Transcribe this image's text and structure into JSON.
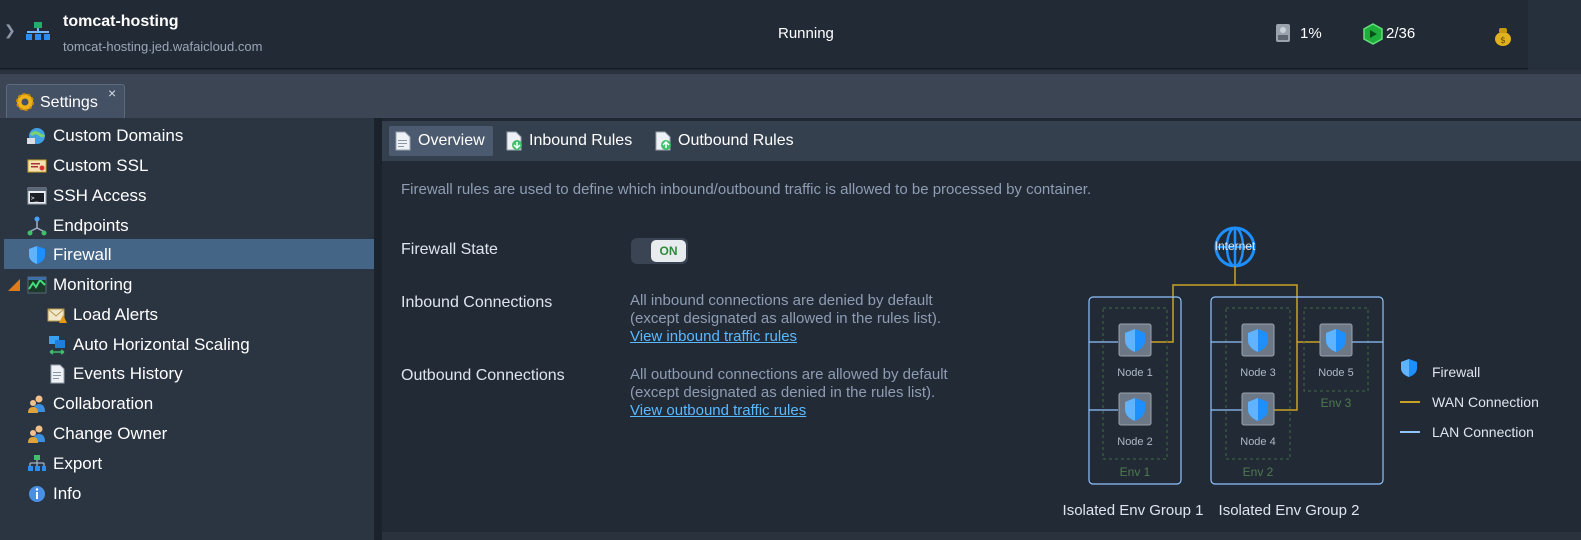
{
  "env": {
    "name": "tomcat-hosting",
    "domain": "tomcat-hosting.jed.wafaicloud.com",
    "status": "Running",
    "disk_usage": "1%",
    "cloudlets": "2/36",
    "icons": [
      "chevron-right-icon",
      "environment-topology-icon",
      "disk-icon",
      "cloudlet-icon",
      "billing-bag-icon"
    ]
  },
  "tab": {
    "label": "Settings",
    "close": "×"
  },
  "sidebar": {
    "items": [
      {
        "label": "Custom Domains"
      },
      {
        "label": "Custom SSL"
      },
      {
        "label": "SSH Access"
      },
      {
        "label": "Endpoints"
      },
      {
        "label": "Firewall"
      },
      {
        "label": "Monitoring"
      },
      {
        "label": "Load Alerts"
      },
      {
        "label": "Auto Horizontal Scaling"
      },
      {
        "label": "Events History"
      },
      {
        "label": "Collaboration"
      },
      {
        "label": "Change Owner"
      },
      {
        "label": "Export"
      },
      {
        "label": "Info"
      }
    ],
    "selected": "Firewall"
  },
  "subtabs": [
    {
      "label": "Overview"
    },
    {
      "label": "Inbound Rules"
    },
    {
      "label": "Outbound Rules"
    }
  ],
  "main": {
    "intro": "Firewall rules are used to define which inbound/outbound traffic is allowed to be processed by container.",
    "firewall_state": {
      "label": "Firewall State",
      "toggle": "ON"
    },
    "inbound": {
      "label": "Inbound Connections",
      "line1": "All inbound connections are denied by default",
      "line2": "(except designated as allowed in the rules list).",
      "link": "View inbound traffic rules"
    },
    "outbound": {
      "label": "Outbound Connections",
      "line1": "All outbound connections are allowed by default",
      "line2": "(except designated as denied in the rules list).",
      "link": "View outbound traffic rules"
    }
  },
  "diagram": {
    "internet": "Internet",
    "nodes": [
      "Node 1",
      "Node 2",
      "Node 3",
      "Node 4",
      "Node 5"
    ],
    "envs": [
      "Env 1",
      "Env 2",
      "Env 3"
    ],
    "groups": [
      "Isolated Env Group 1",
      "Isolated Env Group 2"
    ],
    "legend": [
      {
        "label": "Firewall",
        "color": "#1e8fff"
      },
      {
        "label": "WAN Connection",
        "color": "#c9a227"
      },
      {
        "label": "LAN Connection",
        "color": "#8fc4ff"
      }
    ]
  },
  "colors": {
    "accent": "#456587",
    "link": "#5ab9ff",
    "toggle_on": "#2f8a3a"
  }
}
